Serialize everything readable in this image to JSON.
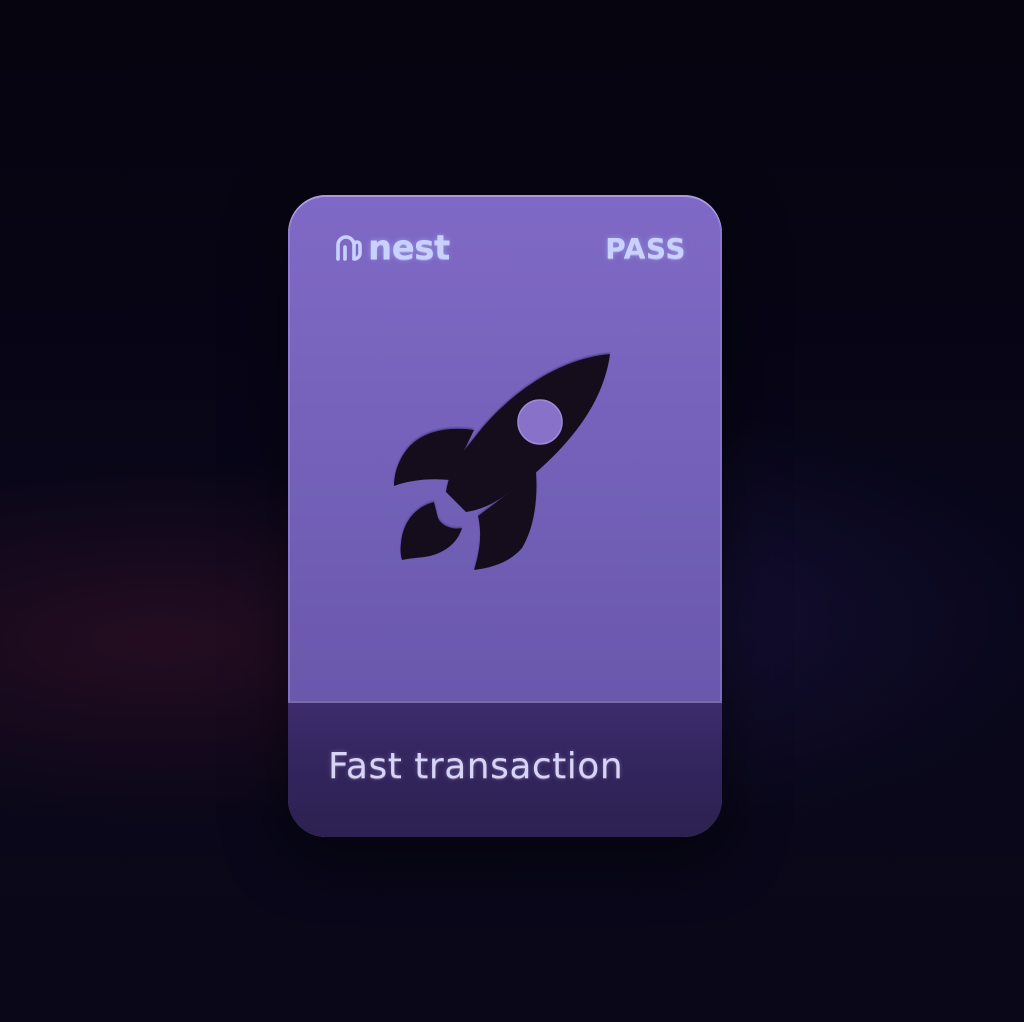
{
  "card": {
    "brand": "nest",
    "badge": "PASS",
    "caption": "Fast transaction",
    "logo_icon": "nest-logo-icon",
    "main_icon": "rocket-icon"
  },
  "colors": {
    "background": "#07050f",
    "card_top": "#7665bb",
    "card_bottom": "#33255d",
    "brand_text": "#c9d2ff",
    "icon": "#12101e"
  }
}
